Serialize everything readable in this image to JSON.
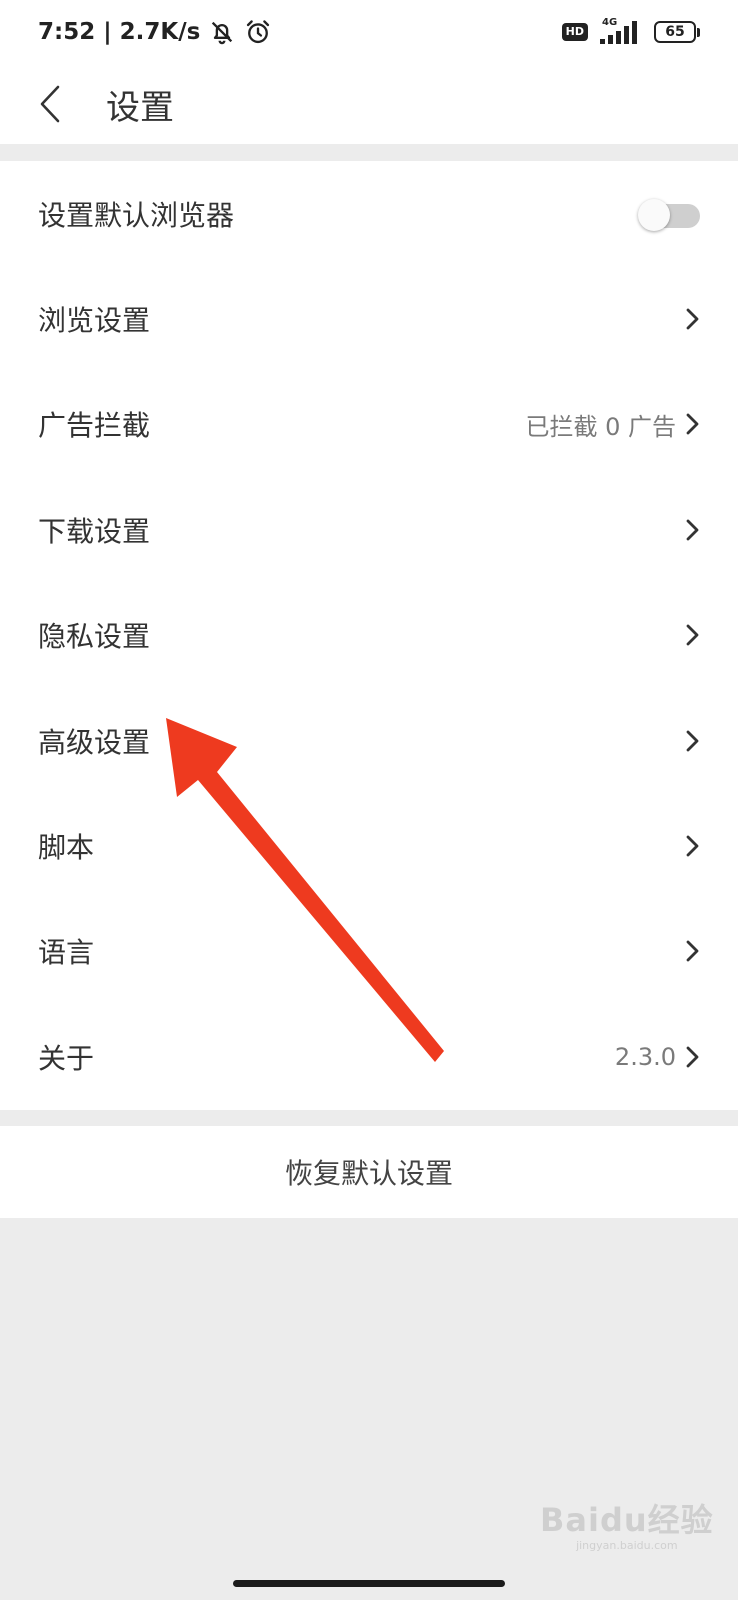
{
  "status_bar": {
    "time": "7:52",
    "separator": "|",
    "net_speed": "2.7K/s",
    "hd": "HD",
    "network": "4G",
    "battery": "65"
  },
  "header": {
    "title": "设置"
  },
  "settings": {
    "default_browser": {
      "label": "设置默认浏览器",
      "enabled": false
    },
    "browsing": {
      "label": "浏览设置"
    },
    "ad_block": {
      "label": "广告拦截",
      "value": "已拦截 0 广告"
    },
    "download": {
      "label": "下载设置"
    },
    "privacy": {
      "label": "隐私设置"
    },
    "advanced": {
      "label": "高级设置"
    },
    "scripts": {
      "label": "脚本"
    },
    "language": {
      "label": "语言"
    },
    "about": {
      "label": "关于",
      "value": "2.3.0"
    }
  },
  "reset": {
    "label": "恢复默认设置"
  },
  "watermark": {
    "brand": "Baidu经验",
    "url": "jingyan.baidu.com"
  },
  "colors": {
    "annotation_arrow": "#ee3a1f",
    "page_bg": "#ececec",
    "card_bg": "#ffffff",
    "text_primary": "#333333",
    "text_secondary": "#7a7a7a"
  }
}
